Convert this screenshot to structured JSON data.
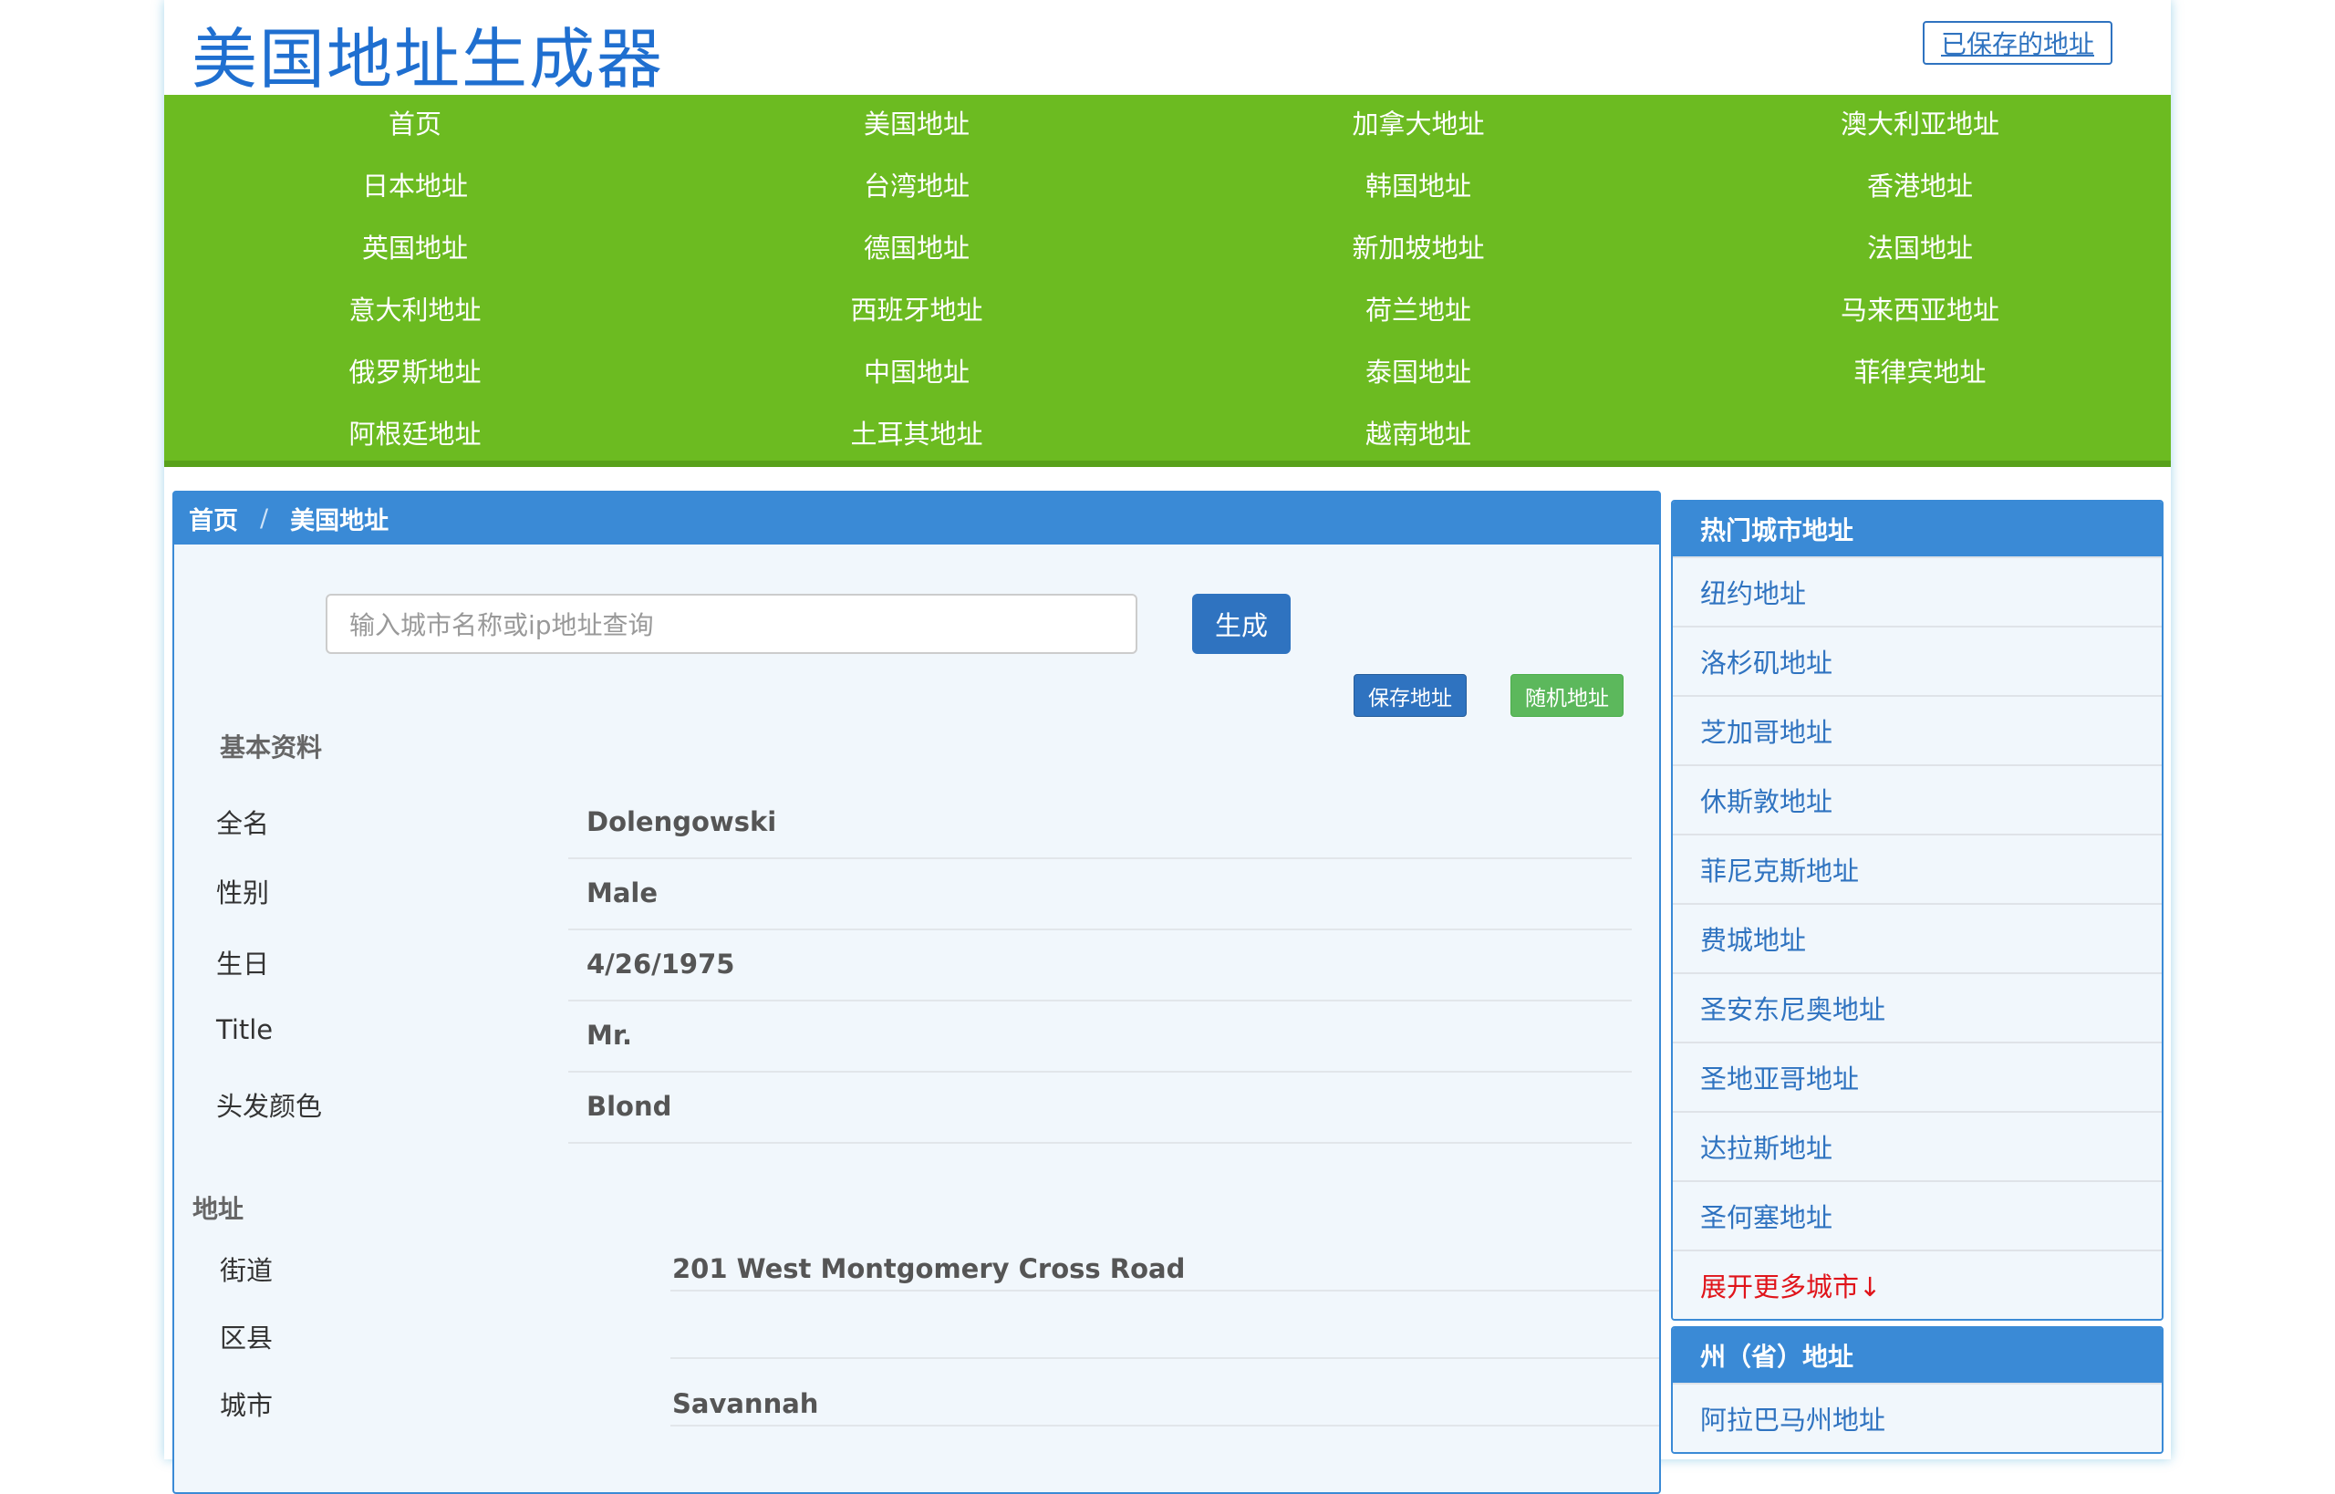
{
  "header": {
    "site_title": "美国地址生成器",
    "saved_addresses_link": "已保存的地址"
  },
  "nav": {
    "items": [
      "首页",
      "美国地址",
      "加拿大地址",
      "澳大利亚地址",
      "日本地址",
      "台湾地址",
      "韩国地址",
      "香港地址",
      "英国地址",
      "德国地址",
      "新加坡地址",
      "法国地址",
      "意大利地址",
      "西班牙地址",
      "荷兰地址",
      "马来西亚地址",
      "俄罗斯地址",
      "中国地址",
      "泰国地址",
      "菲律宾地址",
      "阿根廷地址",
      "土耳其地址",
      "越南地址"
    ]
  },
  "breadcrumb": {
    "home": "首页",
    "separator": "/",
    "current": "美国地址"
  },
  "search": {
    "placeholder": "输入城市名称或ip地址查询",
    "value": "",
    "generate_label": "生成"
  },
  "actions": {
    "save_label": "保存地址",
    "random_label": "随机地址"
  },
  "basic_info": {
    "heading": "基本资料",
    "rows": [
      {
        "label": "全名",
        "value": "Dolengowski"
      },
      {
        "label": "性别",
        "value": "Male"
      },
      {
        "label": "生日",
        "value": "4/26/1975"
      },
      {
        "label": "Title",
        "value": "Mr."
      },
      {
        "label": "头发颜色",
        "value": "Blond"
      }
    ]
  },
  "address": {
    "heading": "地址",
    "rows": [
      {
        "label": "街道",
        "value": "201 West Montgomery Cross Road"
      },
      {
        "label": "区县",
        "value": ""
      },
      {
        "label": "城市",
        "value": "Savannah"
      }
    ]
  },
  "sidebar": {
    "hot_cities": {
      "title": "热门城市地址",
      "items": [
        "纽约地址",
        "洛杉矶地址",
        "芝加哥地址",
        "休斯敦地址",
        "菲尼克斯地址",
        "费城地址",
        "圣安东尼奥地址",
        "圣地亚哥地址",
        "达拉斯地址",
        "圣何塞地址"
      ],
      "more": "展开更多城市↓"
    },
    "states": {
      "title": "州（省）地址",
      "items": [
        "阿拉巴马州地址"
      ]
    }
  },
  "colors": {
    "brand_blue": "#1f6fd0",
    "nav_green": "#6cbb21",
    "panel_blue": "#3a8ad6",
    "button_blue": "#2f73c0",
    "button_green": "#5cb85c",
    "more_red": "#e0141a"
  }
}
